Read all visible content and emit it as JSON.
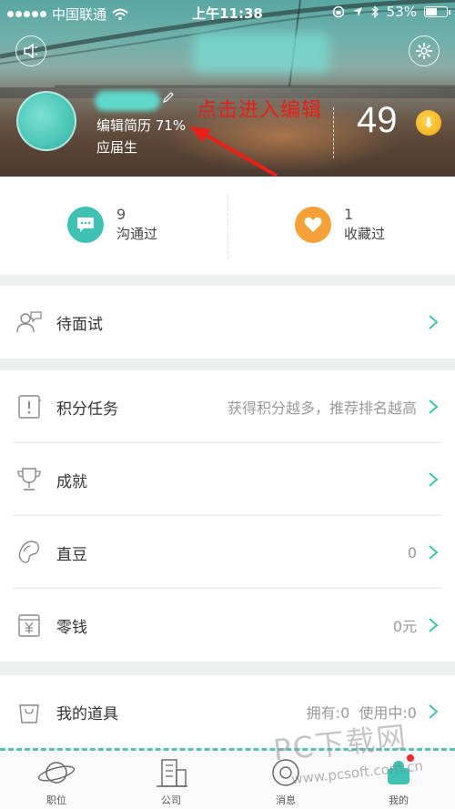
{
  "status_bar": {
    "carrier": "中国联通",
    "time": "上午11:38",
    "battery": "53%",
    "battery_level": 0.53
  },
  "profile": {
    "edit_resume_text": "编辑简历 71%",
    "role": "应届生",
    "annotation": "点击进入编辑",
    "points": "49"
  },
  "stats": [
    {
      "count": "9",
      "label": "沟通过",
      "icon": "chat-bubble-icon",
      "color": "#3fc2b4"
    },
    {
      "count": "1",
      "label": "收藏过",
      "icon": "heart-icon",
      "color": "#f5a13a"
    }
  ],
  "menu": {
    "interview": {
      "label": "待面试",
      "icon": "interview-people-icon"
    },
    "tasks": {
      "label": "积分任务",
      "value": "获得积分越多，推荐排名越高",
      "icon": "task-icon"
    },
    "achievements": {
      "label": "成就",
      "icon": "trophy-icon"
    },
    "beans": {
      "label": "直豆",
      "value": "0",
      "icon": "bean-icon"
    },
    "change": {
      "label": "零钱",
      "value": "0元",
      "icon": "wallet-yuan-icon"
    },
    "props": {
      "label": "我的道具",
      "value": "拥有:0  使用中:0",
      "icon": "bag-icon"
    }
  },
  "tabs": [
    {
      "label": "职位",
      "icon": "planet-icon"
    },
    {
      "label": "公司",
      "icon": "building-icon"
    },
    {
      "label": "消息",
      "icon": "message-icon"
    },
    {
      "label": "我的",
      "icon": "profile-tab-icon"
    }
  ],
  "watermark": {
    "main": "PC下载网",
    "url": "www.pcsoft.com.cn"
  },
  "colors": {
    "accent": "#3fc2b4",
    "annotation_red": "#e8201a",
    "coin": "#f6b51e"
  }
}
